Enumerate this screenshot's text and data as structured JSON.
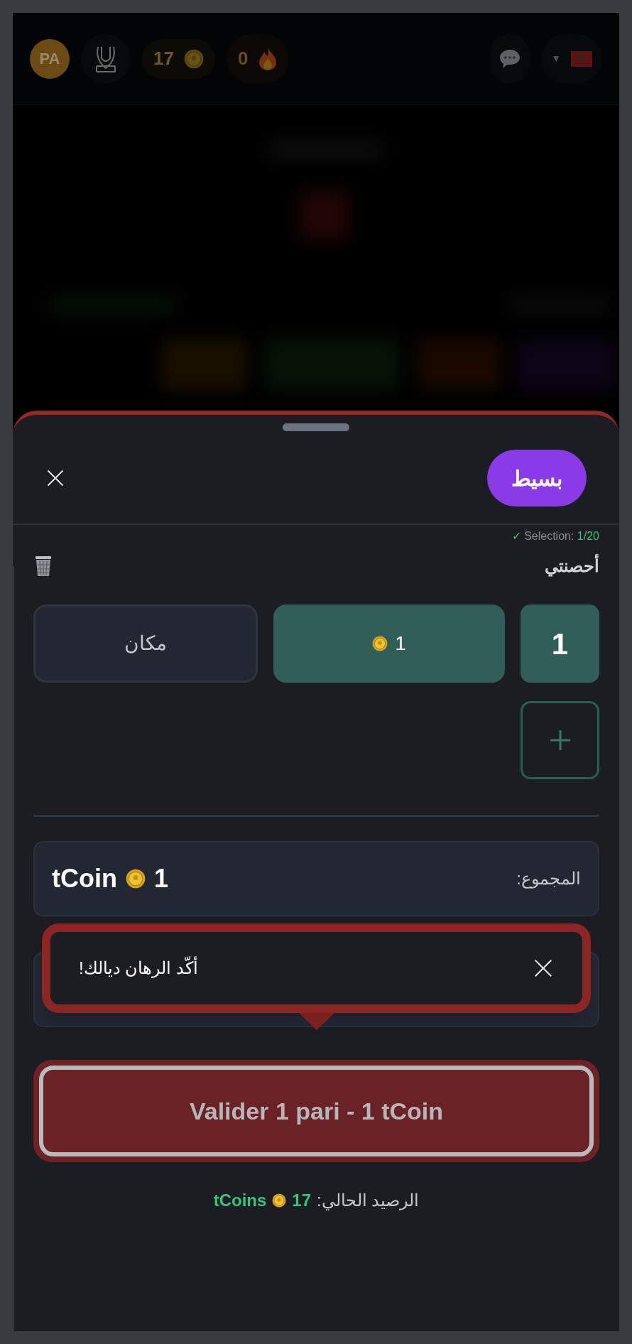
{
  "header": {
    "avatar": "PA",
    "coins": "17",
    "streak": "0",
    "menu_caret": "▼"
  },
  "sheet": {
    "mode_button": "بسيط",
    "selection": {
      "check": "✓",
      "label": "Selection:",
      "value": "1/20"
    },
    "horses_label": "أحصنتي",
    "bets": [
      {
        "number": "1",
        "stake": "1",
        "bet_type": "مكان"
      }
    ],
    "total": {
      "label": "المجموع:",
      "amount": "1",
      "unit": "tCoin"
    },
    "tooltip": {
      "message": "أكّد الرهان ديالك!"
    },
    "submit": {
      "label": "Valider 1 pari - 1 tCoin"
    },
    "balance": {
      "label": "الرصيد الحالي:",
      "amount": "17",
      "unit": "tCoins"
    }
  }
}
